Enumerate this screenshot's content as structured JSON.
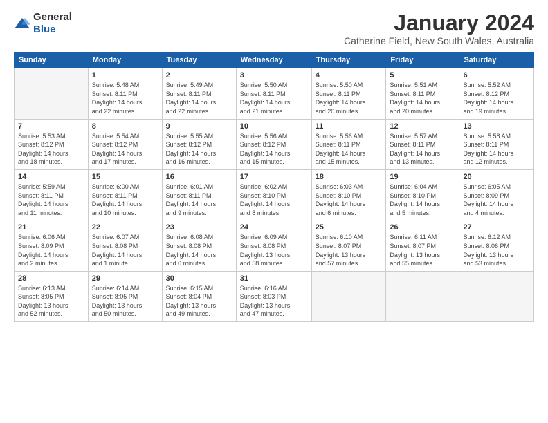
{
  "logo": {
    "text_general": "General",
    "text_blue": "Blue"
  },
  "title": "January 2024",
  "subtitle": "Catherine Field, New South Wales, Australia",
  "days_of_week": [
    "Sunday",
    "Monday",
    "Tuesday",
    "Wednesday",
    "Thursday",
    "Friday",
    "Saturday"
  ],
  "weeks": [
    [
      {
        "day": "",
        "info": ""
      },
      {
        "day": "1",
        "info": "Sunrise: 5:48 AM\nSunset: 8:11 PM\nDaylight: 14 hours\nand 22 minutes."
      },
      {
        "day": "2",
        "info": "Sunrise: 5:49 AM\nSunset: 8:11 PM\nDaylight: 14 hours\nand 22 minutes."
      },
      {
        "day": "3",
        "info": "Sunrise: 5:50 AM\nSunset: 8:11 PM\nDaylight: 14 hours\nand 21 minutes."
      },
      {
        "day": "4",
        "info": "Sunrise: 5:50 AM\nSunset: 8:11 PM\nDaylight: 14 hours\nand 20 minutes."
      },
      {
        "day": "5",
        "info": "Sunrise: 5:51 AM\nSunset: 8:11 PM\nDaylight: 14 hours\nand 20 minutes."
      },
      {
        "day": "6",
        "info": "Sunrise: 5:52 AM\nSunset: 8:12 PM\nDaylight: 14 hours\nand 19 minutes."
      }
    ],
    [
      {
        "day": "7",
        "info": "Sunrise: 5:53 AM\nSunset: 8:12 PM\nDaylight: 14 hours\nand 18 minutes."
      },
      {
        "day": "8",
        "info": "Sunrise: 5:54 AM\nSunset: 8:12 PM\nDaylight: 14 hours\nand 17 minutes."
      },
      {
        "day": "9",
        "info": "Sunrise: 5:55 AM\nSunset: 8:12 PM\nDaylight: 14 hours\nand 16 minutes."
      },
      {
        "day": "10",
        "info": "Sunrise: 5:56 AM\nSunset: 8:12 PM\nDaylight: 14 hours\nand 15 minutes."
      },
      {
        "day": "11",
        "info": "Sunrise: 5:56 AM\nSunset: 8:11 PM\nDaylight: 14 hours\nand 15 minutes."
      },
      {
        "day": "12",
        "info": "Sunrise: 5:57 AM\nSunset: 8:11 PM\nDaylight: 14 hours\nand 13 minutes."
      },
      {
        "day": "13",
        "info": "Sunrise: 5:58 AM\nSunset: 8:11 PM\nDaylight: 14 hours\nand 12 minutes."
      }
    ],
    [
      {
        "day": "14",
        "info": "Sunrise: 5:59 AM\nSunset: 8:11 PM\nDaylight: 14 hours\nand 11 minutes."
      },
      {
        "day": "15",
        "info": "Sunrise: 6:00 AM\nSunset: 8:11 PM\nDaylight: 14 hours\nand 10 minutes."
      },
      {
        "day": "16",
        "info": "Sunrise: 6:01 AM\nSunset: 8:11 PM\nDaylight: 14 hours\nand 9 minutes."
      },
      {
        "day": "17",
        "info": "Sunrise: 6:02 AM\nSunset: 8:10 PM\nDaylight: 14 hours\nand 8 minutes."
      },
      {
        "day": "18",
        "info": "Sunrise: 6:03 AM\nSunset: 8:10 PM\nDaylight: 14 hours\nand 6 minutes."
      },
      {
        "day": "19",
        "info": "Sunrise: 6:04 AM\nSunset: 8:10 PM\nDaylight: 14 hours\nand 5 minutes."
      },
      {
        "day": "20",
        "info": "Sunrise: 6:05 AM\nSunset: 8:09 PM\nDaylight: 14 hours\nand 4 minutes."
      }
    ],
    [
      {
        "day": "21",
        "info": "Sunrise: 6:06 AM\nSunset: 8:09 PM\nDaylight: 14 hours\nand 2 minutes."
      },
      {
        "day": "22",
        "info": "Sunrise: 6:07 AM\nSunset: 8:08 PM\nDaylight: 14 hours\nand 1 minute."
      },
      {
        "day": "23",
        "info": "Sunrise: 6:08 AM\nSunset: 8:08 PM\nDaylight: 14 hours\nand 0 minutes."
      },
      {
        "day": "24",
        "info": "Sunrise: 6:09 AM\nSunset: 8:08 PM\nDaylight: 13 hours\nand 58 minutes."
      },
      {
        "day": "25",
        "info": "Sunrise: 6:10 AM\nSunset: 8:07 PM\nDaylight: 13 hours\nand 57 minutes."
      },
      {
        "day": "26",
        "info": "Sunrise: 6:11 AM\nSunset: 8:07 PM\nDaylight: 13 hours\nand 55 minutes."
      },
      {
        "day": "27",
        "info": "Sunrise: 6:12 AM\nSunset: 8:06 PM\nDaylight: 13 hours\nand 53 minutes."
      }
    ],
    [
      {
        "day": "28",
        "info": "Sunrise: 6:13 AM\nSunset: 8:05 PM\nDaylight: 13 hours\nand 52 minutes."
      },
      {
        "day": "29",
        "info": "Sunrise: 6:14 AM\nSunset: 8:05 PM\nDaylight: 13 hours\nand 50 minutes."
      },
      {
        "day": "30",
        "info": "Sunrise: 6:15 AM\nSunset: 8:04 PM\nDaylight: 13 hours\nand 49 minutes."
      },
      {
        "day": "31",
        "info": "Sunrise: 6:16 AM\nSunset: 8:03 PM\nDaylight: 13 hours\nand 47 minutes."
      },
      {
        "day": "",
        "info": ""
      },
      {
        "day": "",
        "info": ""
      },
      {
        "day": "",
        "info": ""
      }
    ]
  ]
}
